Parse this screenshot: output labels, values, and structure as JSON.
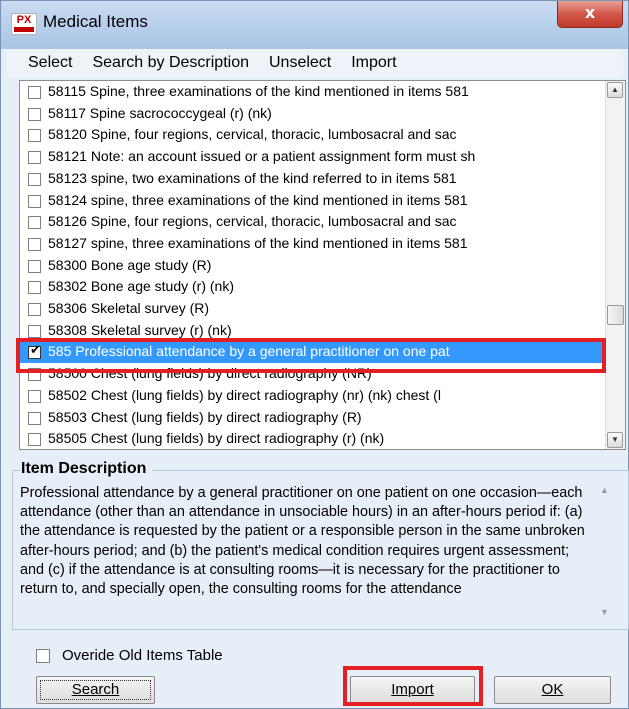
{
  "window": {
    "title": "Medical Items",
    "icon_text": "PX",
    "close_label": "x"
  },
  "menu": [
    "Select",
    "Search by Description",
    "Unselect",
    "Import"
  ],
  "items": [
    {
      "label": "58115 Spine, three examinations of the kind mentioned in items 581",
      "checked": false,
      "selected": false
    },
    {
      "label": "58117 Spine sacrococcygeal (r) (nk)",
      "checked": false,
      "selected": false
    },
    {
      "label": "58120 Spine, four regions, cervical, thoracic, lumbosacral and sac",
      "checked": false,
      "selected": false
    },
    {
      "label": "58121 Note: an account issued or a patient assignment form must sh",
      "checked": false,
      "selected": false
    },
    {
      "label": "58123 spine, two examinations of the kind referred to in items 581",
      "checked": false,
      "selected": false
    },
    {
      "label": "58124 spine, three examinations of the kind mentioned in items 581",
      "checked": false,
      "selected": false
    },
    {
      "label": "58126 Spine, four regions, cervical, thoracic, lumbosacral and sac",
      "checked": false,
      "selected": false
    },
    {
      "label": "58127 spine, three examinations of the kind mentioned in items 581",
      "checked": false,
      "selected": false
    },
    {
      "label": "58300 Bone age study (R)",
      "checked": false,
      "selected": false
    },
    {
      "label": "58302 Bone age study (r) (nk)",
      "checked": false,
      "selected": false
    },
    {
      "label": "58306 Skeletal survey (R)",
      "checked": false,
      "selected": false
    },
    {
      "label": "58308 Skeletal survey (r) (nk)",
      "checked": false,
      "selected": false
    },
    {
      "label": "585 Professional attendance by a general practitioner on one pat",
      "checked": true,
      "selected": true
    },
    {
      "label": "58500 Chest (lung fields) by direct radiography (NR)",
      "checked": false,
      "selected": false
    },
    {
      "label": "58502 Chest (lung fields) by direct radiography (nr) (nk) chest (l",
      "checked": false,
      "selected": false
    },
    {
      "label": "58503 Chest (lung fields) by direct radiography (R)",
      "checked": false,
      "selected": false
    },
    {
      "label": "58505 Chest (lung fields) by direct radiography (r) (nk)",
      "checked": false,
      "selected": false
    }
  ],
  "list_scroll": {
    "position": 0.66
  },
  "description": {
    "title": "Item Description",
    "text": "Professional attendance by a general practitioner on one patient on one occasion—each attendance (other than an attendance in unsociable hours) in an after-hours period if: (a) the attendance is requested by the patient or a responsible person in the same unbroken after-hours period; and (b) the patient's medical condition requires urgent assessment; and (c) if the attendance is at consulting rooms—it is necessary for the practitioner to return to, and specially open, the consulting rooms for the attendance"
  },
  "override": {
    "label": "Overide Old Items Table",
    "checked": false
  },
  "buttons": {
    "search": "Search",
    "import": "Import",
    "ok": "OK"
  },
  "colors": {
    "selection": "#3399ff",
    "annotation_red": "#e31e24"
  }
}
